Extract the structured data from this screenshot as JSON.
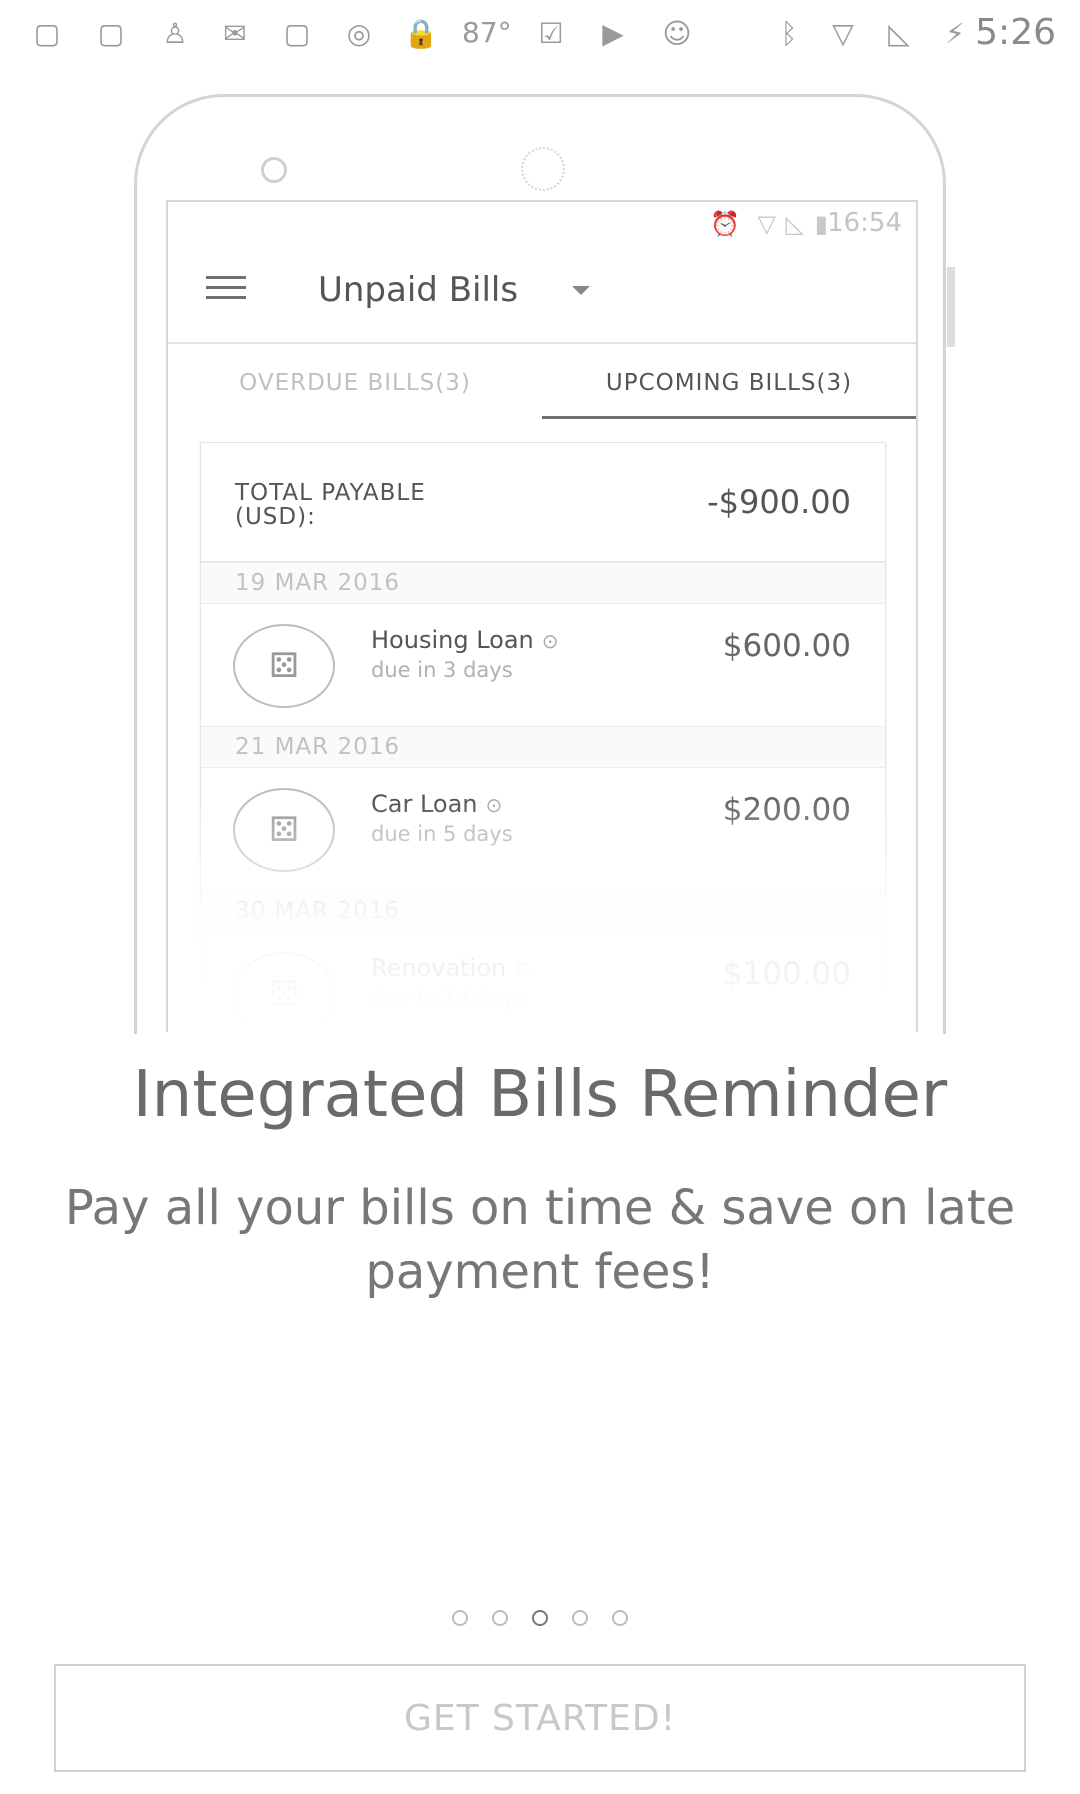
{
  "status_bar": {
    "icons_left": [
      "facebook-icon",
      "facebook-icon",
      "keyhole-icon",
      "mail-icon",
      "facebook-icon",
      "circle-icon",
      "lock-icon"
    ],
    "temperature": "87°",
    "icons_mid": [
      "clipboard-check-icon",
      "play-store-icon",
      "android-icon"
    ],
    "icons_right": [
      "bluetooth-icon",
      "wifi-icon",
      "no-sim-icon",
      "battery-charging-icon"
    ],
    "time": "5:26"
  },
  "phone_mockup": {
    "status_time": "16:54",
    "app_title": "Unpaid Bills",
    "tabs": [
      {
        "label": "OVERDUE BILLS(3)",
        "active": false
      },
      {
        "label": "UPCOMING BILLS(3)",
        "active": true
      }
    ],
    "total_label": "TOTAL PAYABLE (USD):",
    "total_value": "-$900.00",
    "groups": [
      {
        "date": "19 MAR 2016",
        "name": "Housing Loan",
        "due": "due in 3 days",
        "amount": "$600.00"
      },
      {
        "date": "21 MAR 2016",
        "name": "Car Loan",
        "due": "due in 5 days",
        "amount": "$200.00"
      },
      {
        "date": "30 MAR 2016",
        "name": "Renovation",
        "due": "due in 14 days",
        "amount": "$100.00"
      }
    ]
  },
  "onboarding": {
    "title": "Integrated Bills Reminder",
    "subtitle": "Pay all your bills on time & save on late payment fees!",
    "page_count": 5,
    "active_page": 3,
    "cta_label": "GET STARTED!"
  }
}
